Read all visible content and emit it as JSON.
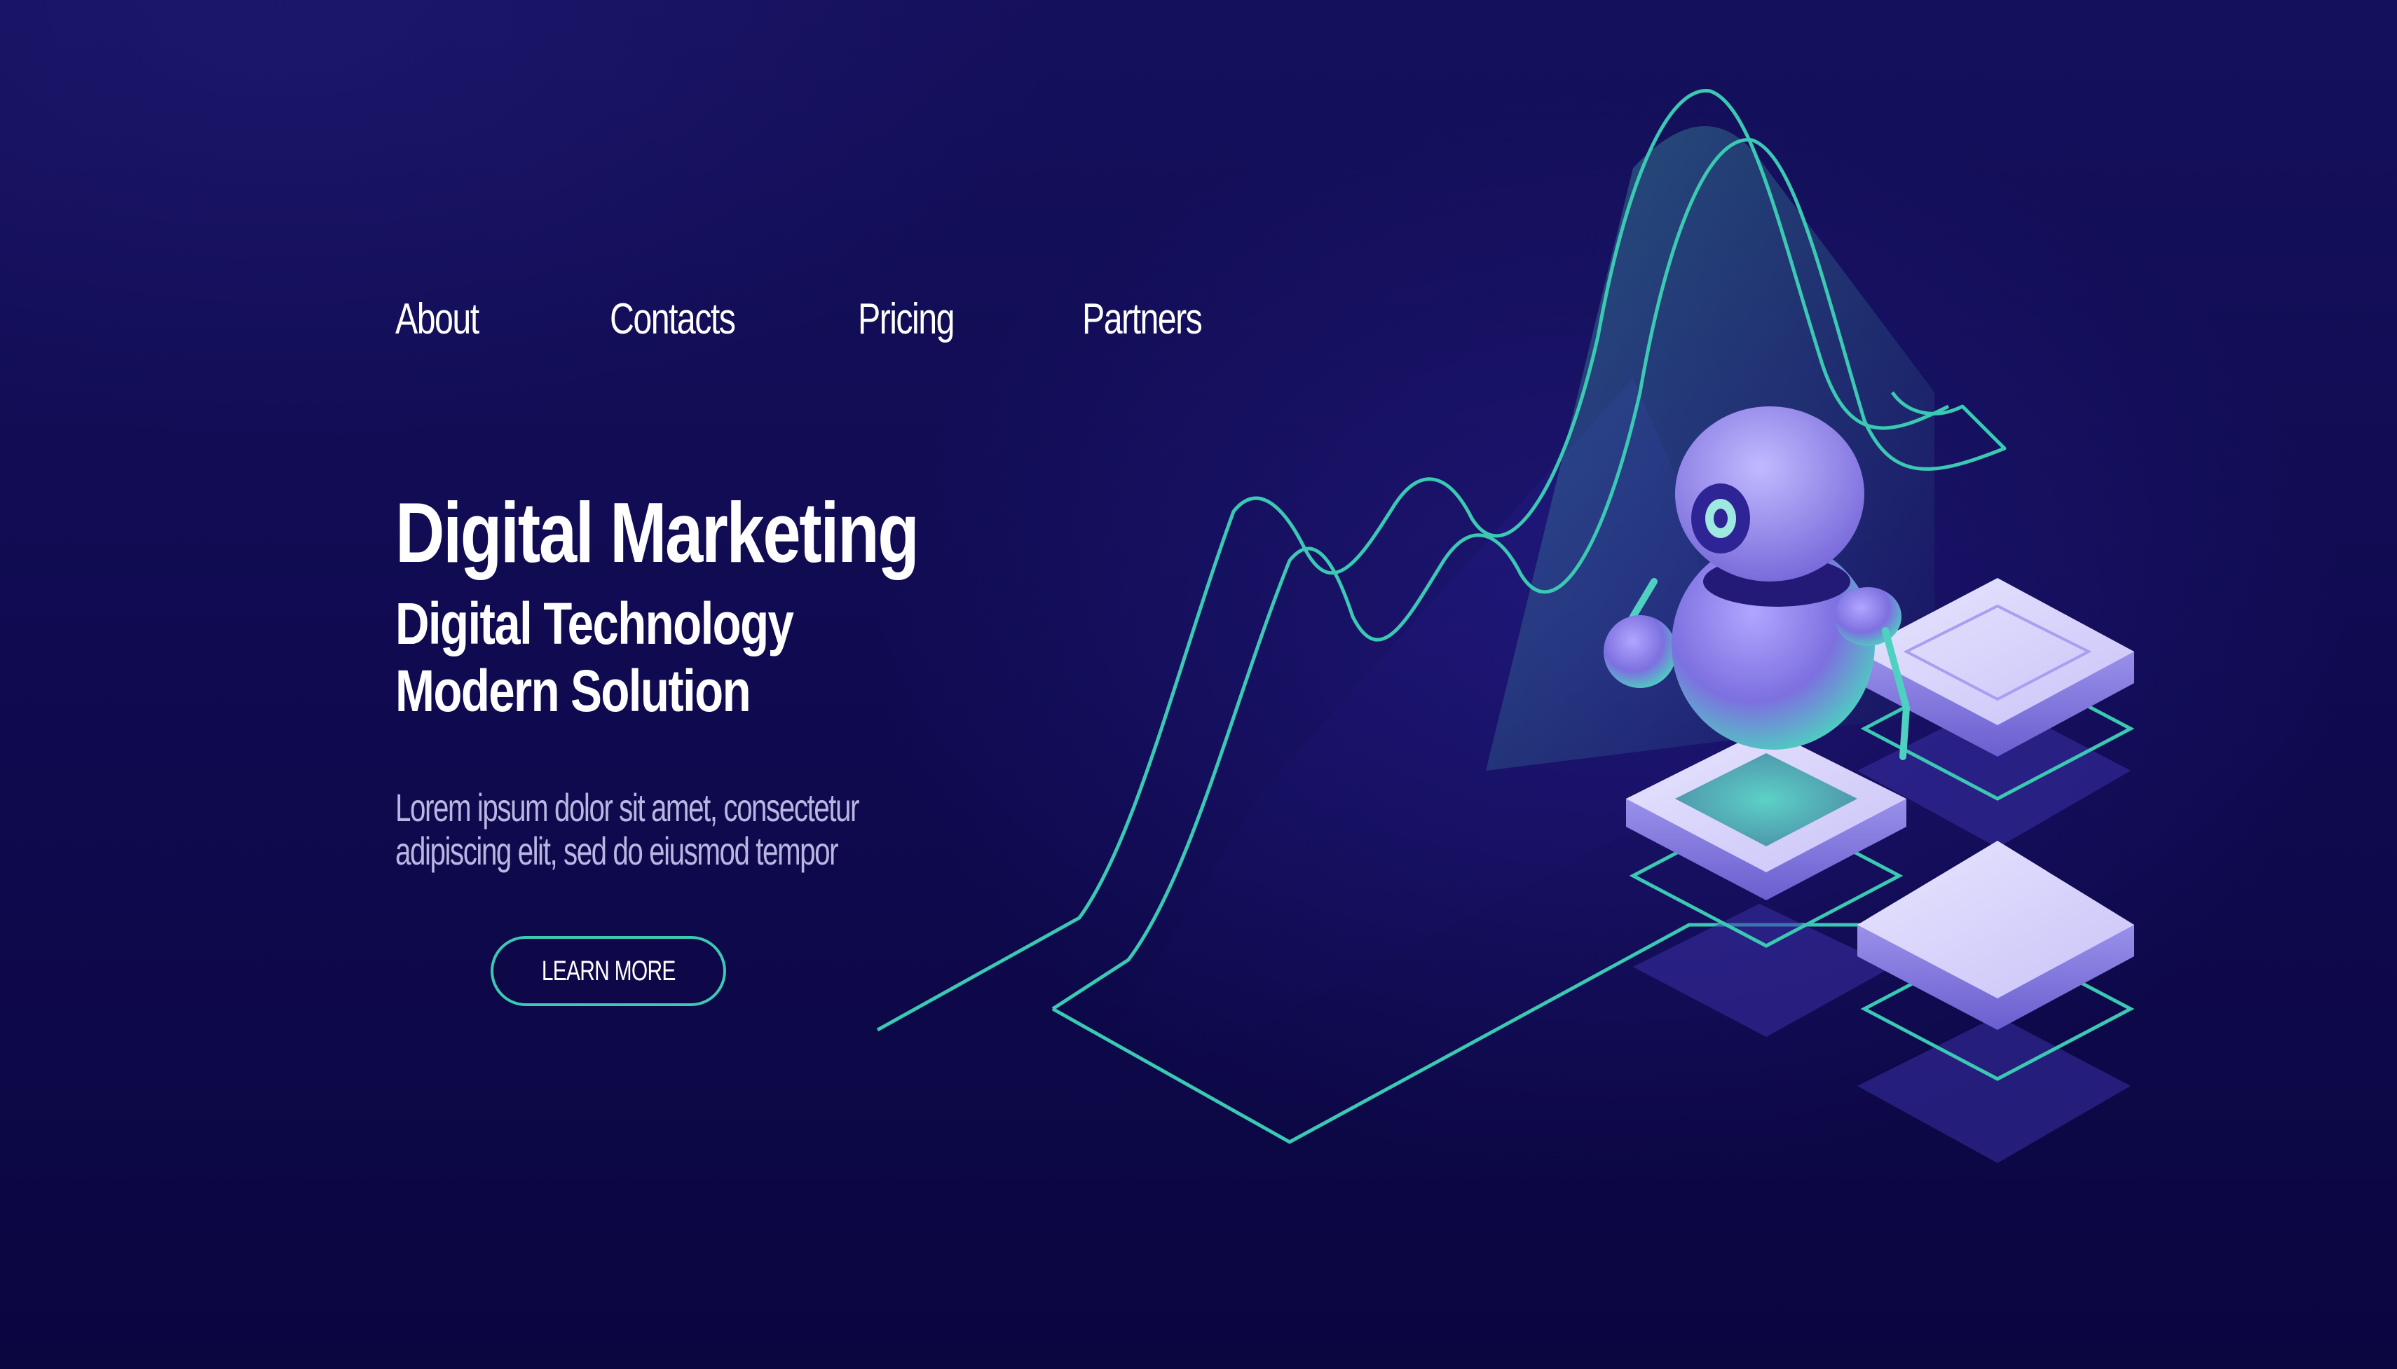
{
  "nav": {
    "items": [
      {
        "label": "About"
      },
      {
        "label": "Contacts"
      },
      {
        "label": "Pricing"
      },
      {
        "label": "Partners"
      }
    ]
  },
  "hero": {
    "title": "Digital Marketing",
    "subtitle_line1": "Digital Technology",
    "subtitle_line2": "Modern Solution",
    "description_line1": "Lorem ipsum dolor sit amet, consectetur",
    "description_line2": "adipiscing elit, sed do eiusmod tempor",
    "cta_label": "LEARN MORE"
  },
  "theme": {
    "background": "#0e0849",
    "accent_teal": "#3bc9b3",
    "robot_purple": "#8c82e8",
    "platform_lavender": "#d8d4fa"
  },
  "illustration": {
    "subject": "isometric robot on server platforms with line chart",
    "icon": "robot-icon"
  }
}
